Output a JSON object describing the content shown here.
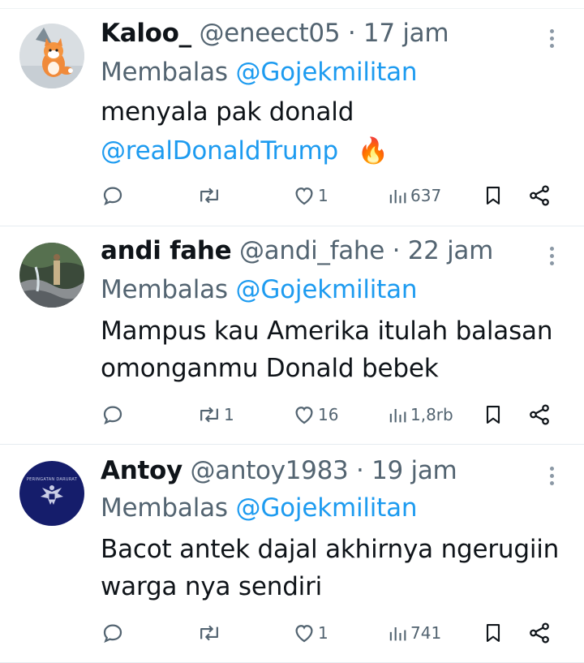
{
  "tweets": [
    {
      "name": "Kaloo_",
      "handle": "@eneect05",
      "time": "· 17 jam",
      "reply_prefix": "Membalas",
      "reply_to": "@Gojekmilitan",
      "line1": "menyala pak donald",
      "line2_mention": "@realDonaldTrump",
      "line2_emoji": "🔥",
      "replies": "",
      "retweets": "",
      "likes": "1",
      "views": "637",
      "avatar_icon": "fox-plush-avatar"
    },
    {
      "name": "andi fahe",
      "handle": "@andi_fahe",
      "time": "· 22 jam",
      "reply_prefix": "Membalas",
      "reply_to": "@Gojekmilitan",
      "line1": "Mampus kau Amerika itulah balasan",
      "line2": "omonganmu Donald bebek",
      "replies": "",
      "retweets": "1",
      "likes": "16",
      "views": "1,8rb",
      "avatar_icon": "waterfall-photo-avatar"
    },
    {
      "name": "Antoy",
      "handle": "@antoy1983",
      "time": "· 19 jam",
      "reply_prefix": "Membalas",
      "reply_to": "@Gojekmilitan",
      "line1": "Bacot antek dajal akhirnya ngerugiin",
      "line2": "warga nya sendiri",
      "replies": "",
      "retweets": "",
      "likes": "1",
      "views": "741",
      "avatar_icon": "garuda-emblem-avatar",
      "avatar_text": "PERINGATAN DARURAT"
    }
  ],
  "colors": {
    "accent": "#1d9bf0",
    "muted": "#536471",
    "text": "#0f1419",
    "divider": "#e6ecf0"
  }
}
